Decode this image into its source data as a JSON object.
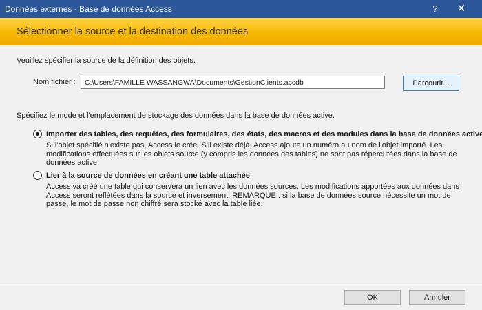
{
  "window": {
    "title": "Données externes - Base de données Access",
    "help_glyph": "?",
    "close_glyph": "✕"
  },
  "header": {
    "title": "Sélectionner la source et la destination des données"
  },
  "source": {
    "instruction": "Veuillez spécifier la source de la définition des objets.",
    "file_label": "Nom fichier :",
    "file_value": "C:\\Users\\FAMILLE WASSANGWA\\Documents\\GestionClients.accdb",
    "browse_label": "Parcourir..."
  },
  "mode": {
    "instruction": "Spécifiez le mode et l'emplacement de stockage des données dans la base de données active.",
    "options": [
      {
        "label": "Importer des tables, des requêtes, des formulaires, des états, des macros et des modules dans la base de données active.",
        "selected": true,
        "description": [
          "Si l'objet spécifié n'existe pas, Access le crée. S'il existe déjà, Access ajoute un numéro au nom de l'objet importé. Les",
          "modifications effectuées sur les objets source (y compris les données des tables) ne sont pas répercutées dans la base de",
          "données active."
        ]
      },
      {
        "label": "Lier à la source de données en créant une table attachée",
        "selected": false,
        "description": [
          "Access va créé une table qui conservera un lien avec les données sources. Les modifications apportées aux données dans",
          "Access seront reflétées dans la source et inversement. REMARQUE : si la base de données source nécessite un mot de",
          "passe, le mot de passe non chiffré sera stocké avec la table liée."
        ]
      }
    ]
  },
  "footer": {
    "ok_label": "OK",
    "cancel_label": "Annuler"
  },
  "colors": {
    "titlebar": "#2b579a",
    "header_band": "#f5b800",
    "window_bg": "#f0f0f0"
  }
}
